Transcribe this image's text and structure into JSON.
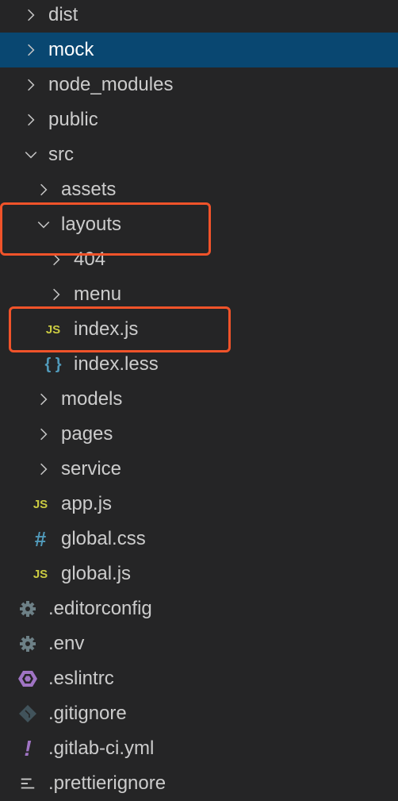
{
  "tree": [
    {
      "label": "dist",
      "type": "folder",
      "open": false,
      "level": 0
    },
    {
      "label": "mock",
      "type": "folder",
      "open": false,
      "level": 0,
      "selected": true
    },
    {
      "label": "node_modules",
      "type": "folder",
      "open": false,
      "level": 0
    },
    {
      "label": "public",
      "type": "folder",
      "open": false,
      "level": 0
    },
    {
      "label": "src",
      "type": "folder",
      "open": true,
      "level": 0
    },
    {
      "label": "assets",
      "type": "folder",
      "open": false,
      "level": 1
    },
    {
      "label": "layouts",
      "type": "folder",
      "open": true,
      "level": 1,
      "highlighted": true
    },
    {
      "label": "404",
      "type": "folder",
      "open": false,
      "level": 2
    },
    {
      "label": "menu",
      "type": "folder",
      "open": false,
      "level": 2
    },
    {
      "label": "index.js",
      "type": "file",
      "icon": "js-icon",
      "level": 2,
      "highlighted": true
    },
    {
      "label": "index.less",
      "type": "file",
      "icon": "braces-icon",
      "level": 2
    },
    {
      "label": "models",
      "type": "folder",
      "open": false,
      "level": 1
    },
    {
      "label": "pages",
      "type": "folder",
      "open": false,
      "level": 1
    },
    {
      "label": "service",
      "type": "folder",
      "open": false,
      "level": 1
    },
    {
      "label": "app.js",
      "type": "file",
      "icon": "js-icon",
      "level": 1
    },
    {
      "label": "global.css",
      "type": "file",
      "icon": "hash-icon",
      "level": 1
    },
    {
      "label": "global.js",
      "type": "file",
      "icon": "js-icon",
      "level": 1
    },
    {
      "label": ".editorconfig",
      "type": "file",
      "icon": "gear-icon",
      "level": 0
    },
    {
      "label": ".env",
      "type": "file",
      "icon": "gear-icon",
      "level": 0
    },
    {
      "label": ".eslintrc",
      "type": "file",
      "icon": "eslint-icon",
      "level": 0
    },
    {
      "label": ".gitignore",
      "type": "file",
      "icon": "git-icon",
      "level": 0
    },
    {
      "label": ".gitlab-ci.yml",
      "type": "file",
      "icon": "exclamation-icon",
      "level": 0
    },
    {
      "label": ".prettierignore",
      "type": "file",
      "icon": "lines-icon",
      "level": 0
    }
  ],
  "icon_glyphs": {
    "js-icon": "JS",
    "braces-icon": "{ }",
    "hash-icon": "#",
    "exclamation-icon": "!"
  },
  "colors": {
    "selected": "#094771",
    "highlight": "#f0532a",
    "js": "#cbcb41",
    "css": "#519aba",
    "gear": "#6d8086",
    "eslint": "#a074c4",
    "git": "#41535b"
  }
}
